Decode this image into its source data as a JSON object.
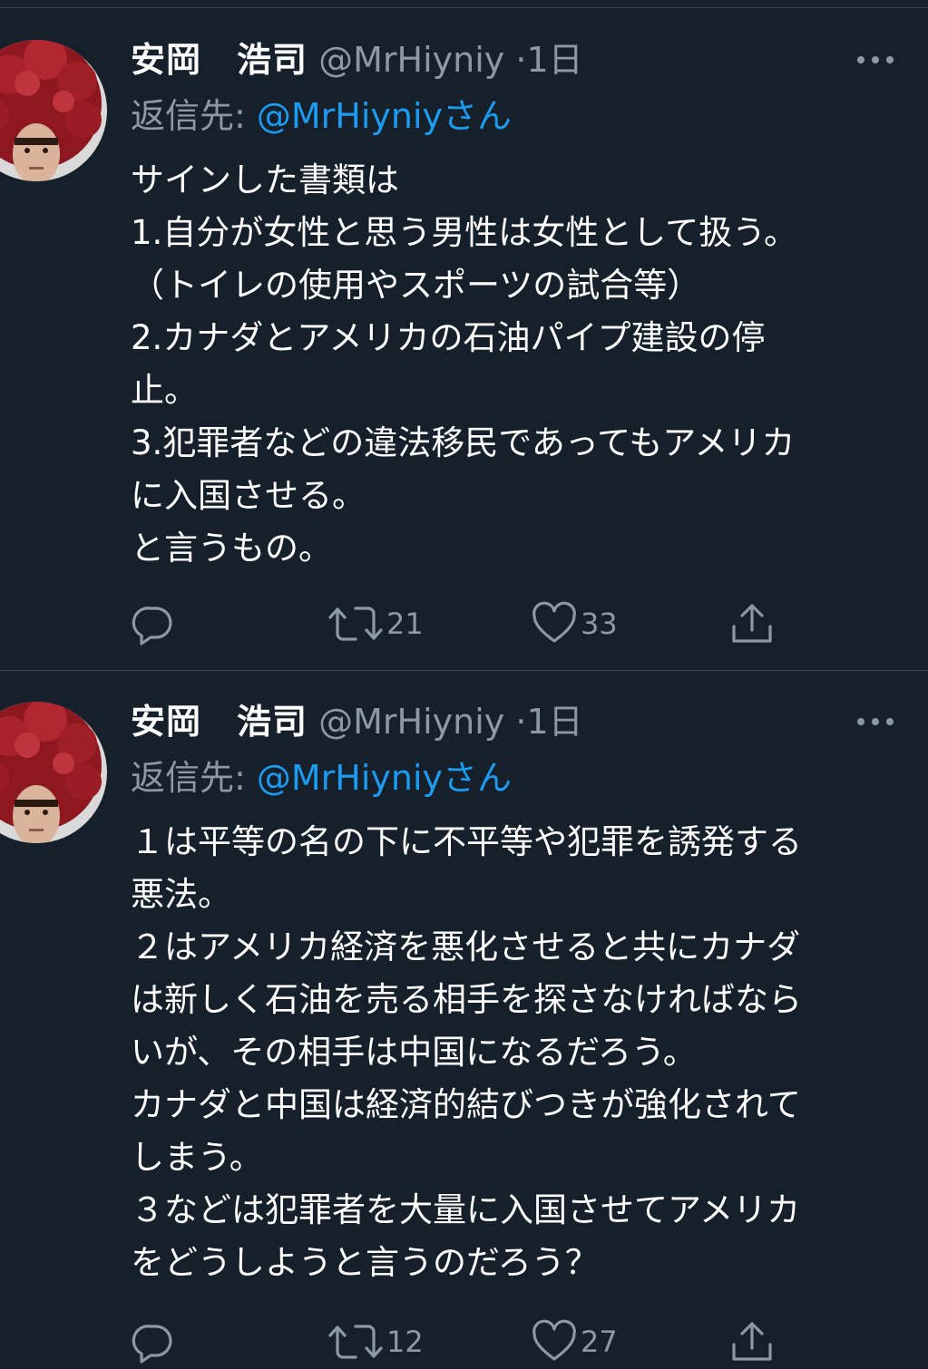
{
  "colors": {
    "background": "#15202b",
    "text": "#ffffff",
    "secondary": "#8b98a5",
    "link": "#1d9bf0",
    "divider": "#38444d"
  },
  "tweets": [
    {
      "display_name": "安岡　浩司",
      "handle": "@MrHiyniy",
      "separator": "·",
      "time": "1日",
      "reply_prefix": "返信先: ",
      "reply_mention": "@MrHiyniyさん",
      "lines": [
        "サインした書類は",
        "1.自分が女性と思う男性は女性として扱う。",
        "（トイレの使用やスポーツの試合等）",
        "2.カナダとアメリカの石油パイプ建設の停",
        "止。",
        "3.犯罪者などの違法移民であってもアメリカ",
        "に入国させる。",
        "と言うもの。"
      ],
      "reply_count": "",
      "retweet_count": "21",
      "like_count": "33",
      "icons": [
        "reply-icon",
        "retweet-icon",
        "like-icon",
        "share-icon"
      ]
    },
    {
      "display_name": "安岡　浩司",
      "handle": "@MrHiyniy",
      "separator": "·",
      "time": "1日",
      "reply_prefix": "返信先: ",
      "reply_mention": "@MrHiyniyさん",
      "lines": [
        "１は平等の名の下に不平等や犯罪を誘発する",
        "悪法。",
        "２はアメリカ経済を悪化させると共にカナダ",
        "は新しく石油を売る相手を探さなければなら",
        "いが、その相手は中国になるだろう。",
        "カナダと中国は経済的結びつきが強化されて",
        "しまう。",
        "３などは犯罪者を大量に入国させてアメリカ",
        "をどうしようと言うのだろう？"
      ],
      "reply_count": "",
      "retweet_count": "12",
      "like_count": "27",
      "icons": [
        "reply-icon",
        "retweet-icon",
        "like-icon",
        "share-icon"
      ]
    }
  ]
}
